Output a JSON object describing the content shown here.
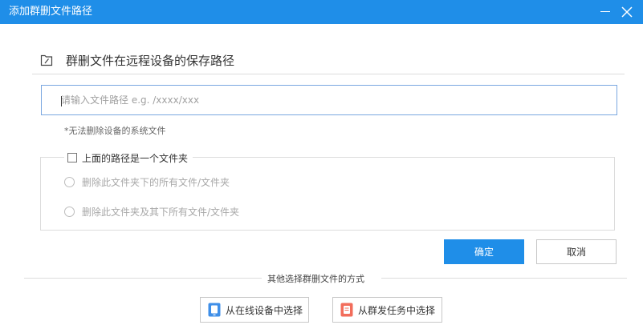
{
  "window": {
    "title": "添加群删文件路径"
  },
  "section": {
    "title": "群删文件在远程设备的保存路径"
  },
  "path_input": {
    "value": "",
    "placeholder": "请输入文件路径 e.g. /xxxx/xxx"
  },
  "note": "*无法删除设备的系统文件",
  "folder_option": {
    "checkbox_label": "上面的路径是一个文件夹",
    "checked": false,
    "radios": [
      {
        "label": "删除此文件夹下的所有文件/文件夹",
        "selected": false
      },
      {
        "label": "删除此文件夹及其下所有文件/文件夹",
        "selected": false
      }
    ]
  },
  "buttons": {
    "ok": "确定",
    "cancel": "取消"
  },
  "other_methods": {
    "label": "其他选择群删文件的方式",
    "online_devices": "从在线设备中选择",
    "batch_tasks": "从群发任务中选择"
  },
  "colors": {
    "accent": "#1f8ee8",
    "online_icon": "#3f8fe8",
    "task_icon": "#f26d5b"
  }
}
